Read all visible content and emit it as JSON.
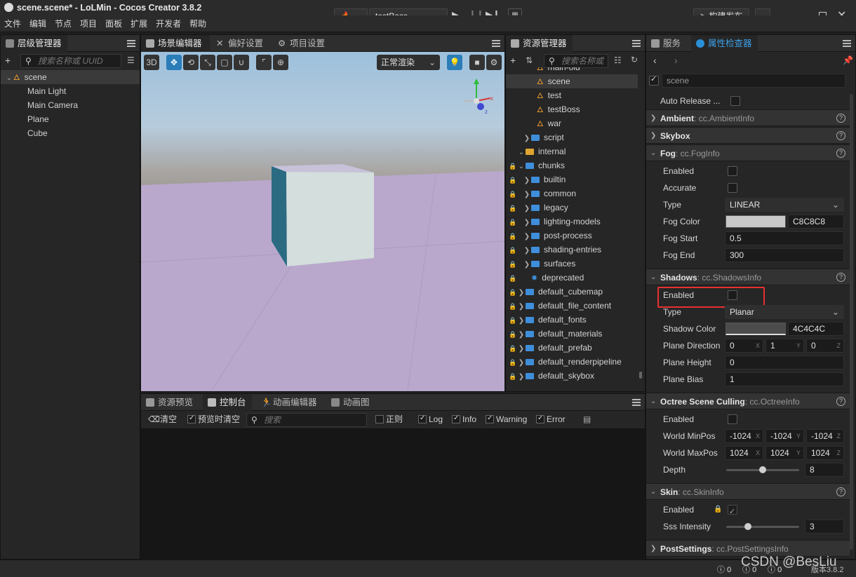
{
  "window": {
    "title": "scene.scene* - LoLMin - Cocos Creator 3.8.2"
  },
  "menu": [
    "文件",
    "编辑",
    "节点",
    "项目",
    "面板",
    "扩展",
    "开发者",
    "帮助"
  ],
  "toolbar": {
    "scene_select": "testBoss",
    "publish": "构建发布"
  },
  "hierarchy": {
    "tab": "层级管理器",
    "search_placeholder": "搜索名称或 UUID",
    "root": "scene",
    "children": [
      "Main Light",
      "Main Camera",
      "Plane",
      "Cube"
    ]
  },
  "scene_editor": {
    "tabs": [
      "场景编辑器",
      "偏好设置",
      "项目设置"
    ],
    "mode_3d": "3D",
    "render_mode": "正常渲染"
  },
  "assets": {
    "tab": "资源管理器",
    "search_placeholder": "搜索名称或",
    "items": [
      {
        "label": "main-old",
        "type": "scene",
        "indent": 3,
        "lock": false,
        "fold": false
      },
      {
        "label": "scene",
        "type": "scene",
        "indent": 3,
        "lock": false,
        "fold": false,
        "selected": true
      },
      {
        "label": "test",
        "type": "scene",
        "indent": 3,
        "lock": false,
        "fold": false
      },
      {
        "label": "testBoss",
        "type": "scene",
        "indent": 3,
        "lock": false,
        "fold": false
      },
      {
        "label": "war",
        "type": "scene",
        "indent": 3,
        "lock": false,
        "fold": false
      },
      {
        "label": "script",
        "type": "folder",
        "indent": 2,
        "lock": false,
        "fold": "right"
      },
      {
        "label": "internal",
        "type": "db",
        "indent": 1,
        "lock": false,
        "fold": "down"
      },
      {
        "label": "chunks",
        "type": "folder-open",
        "indent": 1,
        "lock": true,
        "fold": "down"
      },
      {
        "label": "builtin",
        "type": "folder",
        "indent": 2,
        "lock": true,
        "fold": "right"
      },
      {
        "label": "common",
        "type": "folder",
        "indent": 2,
        "lock": true,
        "fold": "right"
      },
      {
        "label": "legacy",
        "type": "folder",
        "indent": 2,
        "lock": true,
        "fold": "right"
      },
      {
        "label": "lighting-models",
        "type": "folder",
        "indent": 2,
        "lock": true,
        "fold": "right"
      },
      {
        "label": "post-process",
        "type": "folder",
        "indent": 2,
        "lock": true,
        "fold": "right"
      },
      {
        "label": "shading-entries",
        "type": "folder",
        "indent": 2,
        "lock": true,
        "fold": "right"
      },
      {
        "label": "surfaces",
        "type": "folder",
        "indent": 2,
        "lock": true,
        "fold": "right"
      },
      {
        "label": "deprecated",
        "type": "chunk",
        "indent": 2,
        "lock": true,
        "fold": false
      },
      {
        "label": "default_cubemap",
        "type": "folder",
        "indent": 1,
        "lock": true,
        "fold": "right"
      },
      {
        "label": "default_file_content",
        "type": "folder",
        "indent": 1,
        "lock": true,
        "fold": "right"
      },
      {
        "label": "default_fonts",
        "type": "folder",
        "indent": 1,
        "lock": true,
        "fold": "right"
      },
      {
        "label": "default_materials",
        "type": "folder",
        "indent": 1,
        "lock": true,
        "fold": "right"
      },
      {
        "label": "default_prefab",
        "type": "folder",
        "indent": 1,
        "lock": true,
        "fold": "right"
      },
      {
        "label": "default_renderpipeline",
        "type": "folder",
        "indent": 1,
        "lock": true,
        "fold": "right"
      },
      {
        "label": "default_skybox",
        "type": "folder",
        "indent": 1,
        "lock": true,
        "fold": "right"
      }
    ]
  },
  "inspector": {
    "tabs": [
      "服务",
      "属性检查器"
    ],
    "node_name": "scene",
    "auto_release": "Auto Release ...",
    "ambient": {
      "name": "Ambient",
      "type": ": cc.AmbientInfo"
    },
    "skybox": {
      "name": "Skybox"
    },
    "fog": {
      "name": "Fog",
      "type": ": cc.FogInfo",
      "enabled_label": "Enabled",
      "accurate_label": "Accurate",
      "type_label": "Type",
      "type_value": "LINEAR",
      "color_label": "Fog Color",
      "color_hex": "C8C8C8",
      "color": "#c8c8c8",
      "start_label": "Fog Start",
      "start": "0.5",
      "end_label": "Fog End",
      "end": "300"
    },
    "shadows": {
      "name": "Shadows",
      "type": ": cc.ShadowsInfo",
      "enabled_label": "Enabled",
      "type_label": "Type",
      "type_value": "Planar",
      "color_label": "Shadow Color",
      "color_hex": "4C4C4C",
      "color": "#4c4c4c",
      "dir_label": "Plane Direction",
      "dir": [
        "0",
        "1",
        "0"
      ],
      "height_label": "Plane Height",
      "height": "0",
      "bias_label": "Plane Bias",
      "bias": "1"
    },
    "octree": {
      "name": "Octree Scene Culling",
      "type": ": cc.OctreeInfo",
      "enabled_label": "Enabled",
      "min_label": "World MinPos",
      "min": [
        "-1024",
        "-1024",
        "-1024"
      ],
      "max_label": "World MaxPos",
      "max": [
        "1024",
        "1024",
        "1024"
      ],
      "depth_label": "Depth",
      "depth": "8",
      "depth_level": 0.5
    },
    "skin": {
      "name": "Skin",
      "type": ": cc.SkinInfo",
      "enabled_label": "Enabled",
      "sss_label": "Sss Intensity",
      "sss": "3",
      "sss_level": 0.3
    },
    "post": {
      "name": "PostSettings",
      "type": ": cc.PostSettingsInfo"
    },
    "axes": [
      "X",
      "Y",
      "Z"
    ]
  },
  "console": {
    "tabs": [
      "资源预览",
      "控制台",
      "动画编辑器",
      "动画图"
    ],
    "clear": "清空",
    "clear_on_preview": "预览时清空",
    "search_placeholder": "搜索",
    "regex": "正则",
    "log": "Log",
    "info": "Info",
    "warning": "Warning",
    "error": "Error"
  },
  "statusbar": {
    "errors": "0",
    "warnings": "0",
    "info": "0",
    "version": "版本3.8.2",
    "watermark": "CSDN @BesLiu"
  },
  "colors": {
    "accent": "#2b8fd6",
    "highlight": "#e63030"
  }
}
